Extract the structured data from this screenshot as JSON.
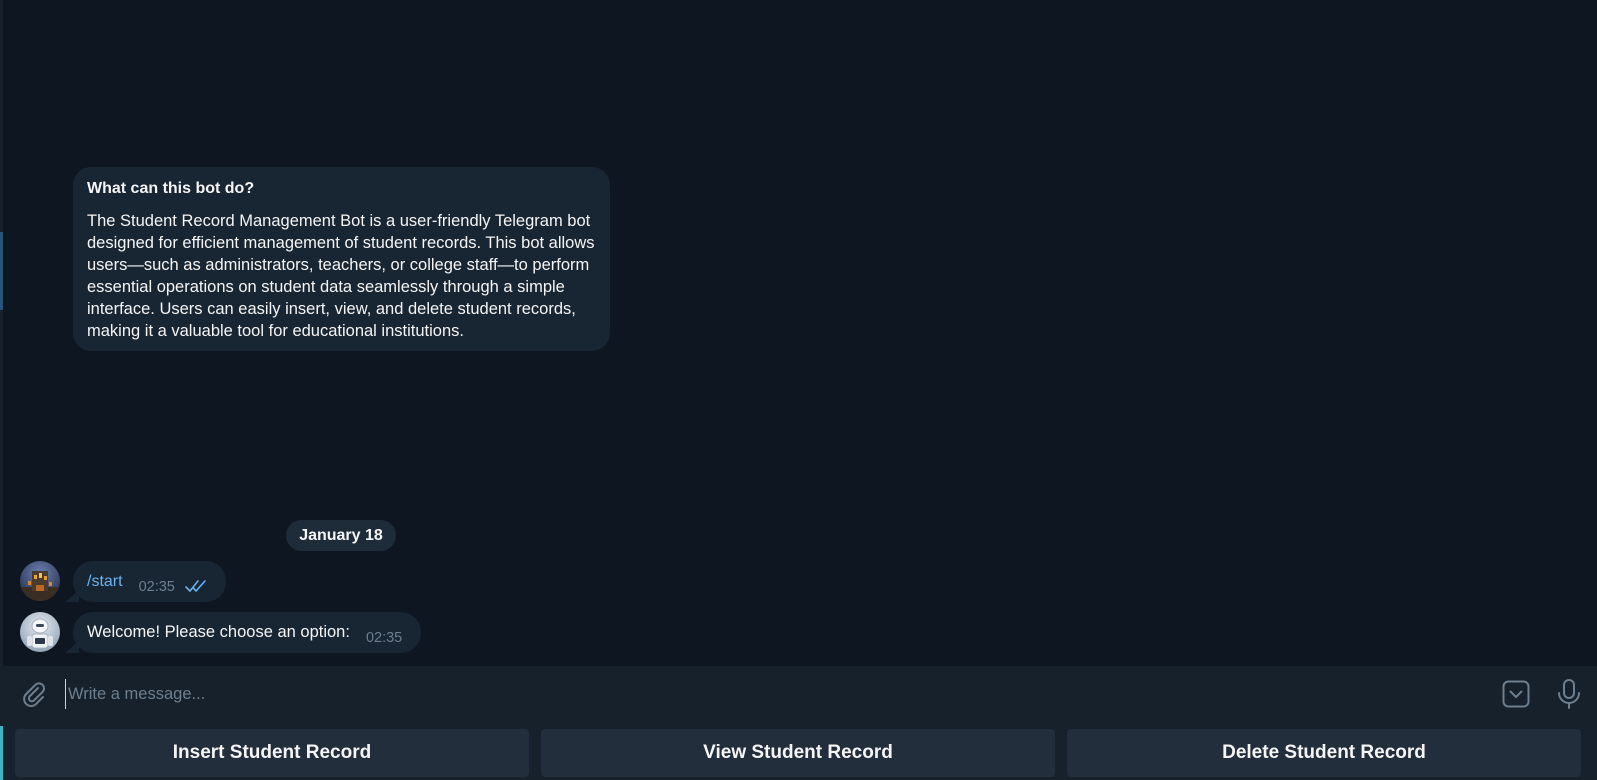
{
  "bot_info": {
    "title": "What can this bot do?",
    "description": "The Student Record Management Bot is a user-friendly Telegram bot designed for efficient management of student records. This bot allows users—such as administrators, teachers, or college staff—to perform essential operations on student data seamlessly through a simple interface. Users can easily insert, view, and delete student records, making it a valuable tool for educational institutions."
  },
  "date_separator": "January 18",
  "messages": [
    {
      "sender": "user",
      "text": "/start",
      "time": "02:35",
      "status_icon": "double-check-icon"
    },
    {
      "sender": "bot",
      "text": "Welcome! Please choose an option:",
      "time": "02:35"
    }
  ],
  "composer": {
    "placeholder": "Write a message...",
    "value": ""
  },
  "keyboard_buttons": [
    "Insert Student Record",
    "View Student Record",
    "Delete Student Record"
  ],
  "colors": {
    "background": "#0e1621",
    "bubble": "#182533",
    "panel": "#17212b",
    "key": "#232e3c",
    "link": "#6ab3f3",
    "muted": "#6d7f8f"
  }
}
